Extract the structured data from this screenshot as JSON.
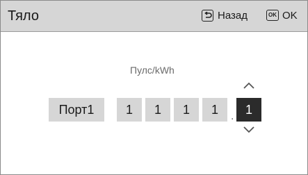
{
  "header": {
    "title": "Тяло",
    "back_label": "Назад",
    "ok_icon_text": "OK",
    "ok_label": "OK",
    "back_icon": "return-arrow-icon",
    "ok_icon": "ok-key-icon"
  },
  "main": {
    "unit_label": "Пулс/kWh",
    "port_label": "Порт1",
    "digits": [
      "1",
      "1",
      "1",
      "1",
      "1"
    ],
    "decimal_separator": ".",
    "selected_digit_index": 4,
    "up_icon": "chevron-up-icon",
    "down_icon": "chevron-down-icon"
  },
  "colors": {
    "header_bg": "#d6d6d6",
    "box_bg": "#d6d6d6",
    "selected_bg": "#2b2b2b",
    "selected_text": "#ffffff"
  }
}
